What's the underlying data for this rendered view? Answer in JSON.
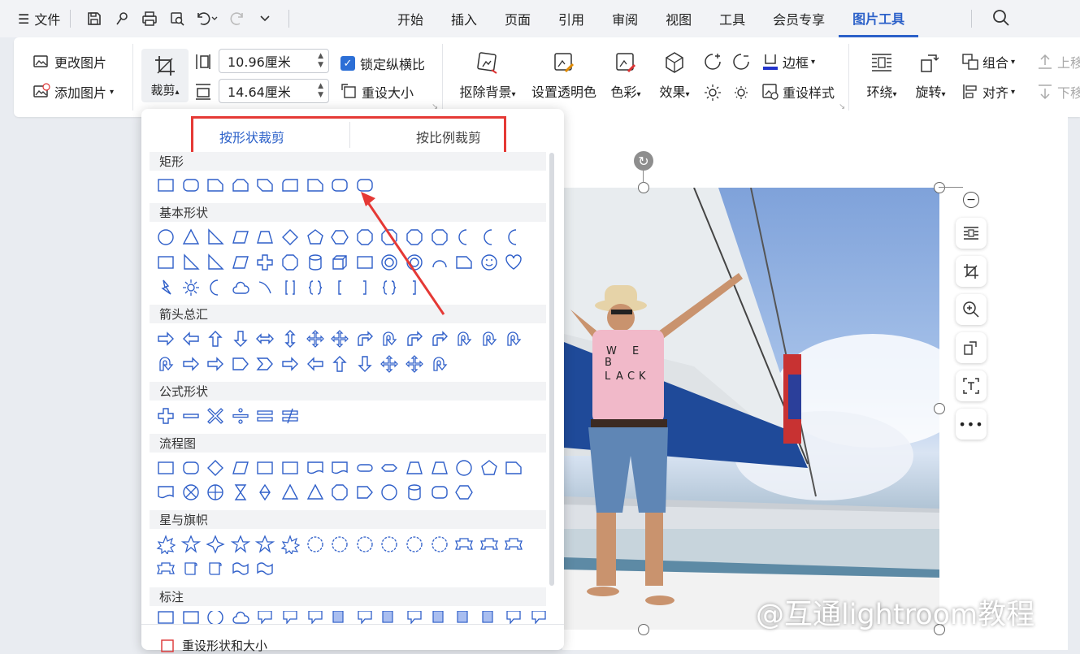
{
  "menubar": {
    "file_label": "文件",
    "tabs": [
      "开始",
      "插入",
      "页面",
      "引用",
      "审阅",
      "视图",
      "工具",
      "会员专享",
      "图片工具"
    ],
    "active_tab": "图片工具"
  },
  "ribbon": {
    "change_picture": "更改图片",
    "add_picture": "添加图片",
    "crop": "裁剪",
    "width_value": "10.96厘米",
    "height_value": "14.64厘米",
    "lock_ratio": "锁定纵横比",
    "reset_size": "重设大小",
    "remove_bg": "抠除背景",
    "set_transparent": "设置透明色",
    "color": "色彩",
    "effect": "效果",
    "border": "边框",
    "reset_style": "重设样式",
    "wrap": "环绕",
    "rotate": "旋转",
    "group": "组合",
    "align": "对齐",
    "move_up": "上移",
    "move_down": "下移"
  },
  "crop_panel": {
    "tab_shape": "按形状裁剪",
    "tab_ratio": "按比例裁剪",
    "categories": [
      "矩形",
      "基本形状",
      "箭头总汇",
      "公式形状",
      "流程图",
      "星与旗帜",
      "标注"
    ],
    "footer": "重设形状和大小"
  },
  "watermark": "@互通lightroom教程",
  "photo_text": [
    "W",
    "E",
    "B",
    "L",
    "A",
    "C",
    "K"
  ],
  "colors": {
    "accent": "#2c61c9",
    "highlight": "#e53935",
    "shape_stroke": "#2f5fc9"
  }
}
